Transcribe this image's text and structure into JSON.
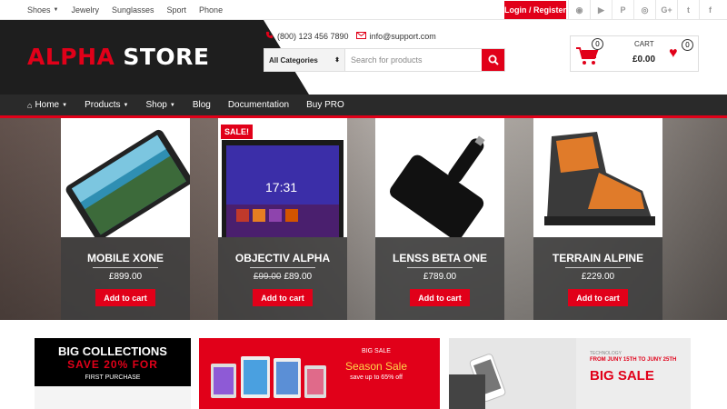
{
  "topbar": {
    "nav": [
      {
        "label": "Shoes",
        "dropdown": true
      },
      {
        "label": "Jewelry",
        "dropdown": false
      },
      {
        "label": "Sunglasses",
        "dropdown": false
      },
      {
        "label": "Sport",
        "dropdown": false
      },
      {
        "label": "Phone",
        "dropdown": false
      }
    ],
    "login_label": "Login / Register",
    "socials": [
      "reddit-icon",
      "youtube-icon",
      "pinterest-icon",
      "instagram-icon",
      "google-plus-icon",
      "twitter-icon",
      "facebook-icon"
    ],
    "social_glyphs": [
      "◉",
      "▶",
      "P",
      "◎",
      "G+",
      "t",
      "f"
    ]
  },
  "header": {
    "logo_accent": "ALPHA",
    "logo_main": "STORE",
    "phone": "(800) 123 456 7890",
    "email": "info@support.com",
    "search_category": "All Categories",
    "search_placeholder": "Search for products",
    "cart": {
      "label": "CART",
      "total": "£0.00",
      "count": "0",
      "wishlist_count": "0"
    }
  },
  "nav": {
    "items": [
      {
        "label": "Home",
        "dropdown": true
      },
      {
        "label": "Products",
        "dropdown": true
      },
      {
        "label": "Shop",
        "dropdown": true
      },
      {
        "label": "Blog",
        "dropdown": false
      },
      {
        "label": "Documentation",
        "dropdown": false
      },
      {
        "label": "Buy PRO",
        "dropdown": false
      }
    ]
  },
  "products": [
    {
      "name": "MOBILE XONE",
      "price": "£899.00",
      "old_price": "",
      "sale": "",
      "button": "Add to cart"
    },
    {
      "name": "OBJECTIV ALPHA",
      "price": "£89.00",
      "old_price": "£99.00",
      "sale": "SALE!",
      "button": "Add to cart"
    },
    {
      "name": "LENSS BETA ONE",
      "price": "£789.00",
      "old_price": "",
      "sale": "",
      "button": "Add to cart"
    },
    {
      "name": "TERRAIN ALPINE",
      "price": "£229.00",
      "old_price": "",
      "sale": "",
      "button": "Add to cart"
    }
  ],
  "banners": {
    "b1": {
      "title": "BIG COLLECTIONS",
      "offer": "SAVE 20% FOR",
      "sub": "FIRST PURCHASE"
    },
    "b2": {
      "kicker": "BIG SALE",
      "title": "Season Sale",
      "sub": "save up to 65% off"
    },
    "b3": {
      "kicker": "TECHNOLOGY",
      "dates": "FROM JUNY 15TH TO JUNY 25TH",
      "title": "BIG SALE"
    }
  },
  "colors": {
    "accent": "#e10019",
    "dark": "#1e1e1e",
    "nav": "#2a2a2a"
  }
}
